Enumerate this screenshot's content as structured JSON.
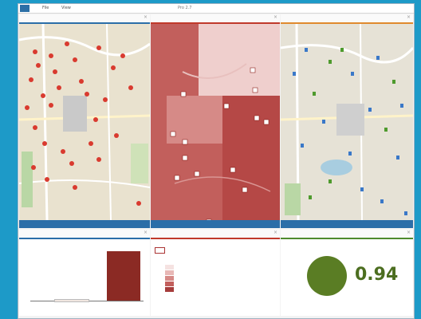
{
  "window": {
    "title": "Pro 2.7"
  },
  "menu": [
    "File",
    "View",
    "Edit"
  ],
  "panes": {
    "points_map": {
      "title": ""
    },
    "choropleth_map": {
      "title": ""
    },
    "category_map": {
      "title": ""
    },
    "bar_chart": {
      "title": ""
    },
    "legend": {
      "title": ""
    },
    "gauge": {
      "title": ""
    }
  },
  "legend": {
    "heading": "",
    "subheading": "",
    "classes": [
      {
        "label": "",
        "color": "#f5e2e1"
      },
      {
        "label": "",
        "color": "#e8b8b6"
      },
      {
        "label": "",
        "color": "#d68a87"
      },
      {
        "label": "",
        "color": "#c25f5c"
      },
      {
        "label": "",
        "color": "#a53c3b"
      }
    ]
  },
  "gauge": {
    "value": "0.94",
    "color": "#5a7d24"
  },
  "colors": {
    "accent_blue": "#2b6ea8",
    "accent_red": "#c0392b",
    "accent_orange": "#e08a2e",
    "accent_green": "#4e8a2d"
  },
  "chart_data": {
    "type": "bar",
    "categories": [
      "",
      ""
    ],
    "values": [
      3,
      95
    ],
    "ylim": [
      0,
      110
    ],
    "colors": [
      "#f0e6e0",
      "#8b2a24"
    ]
  }
}
